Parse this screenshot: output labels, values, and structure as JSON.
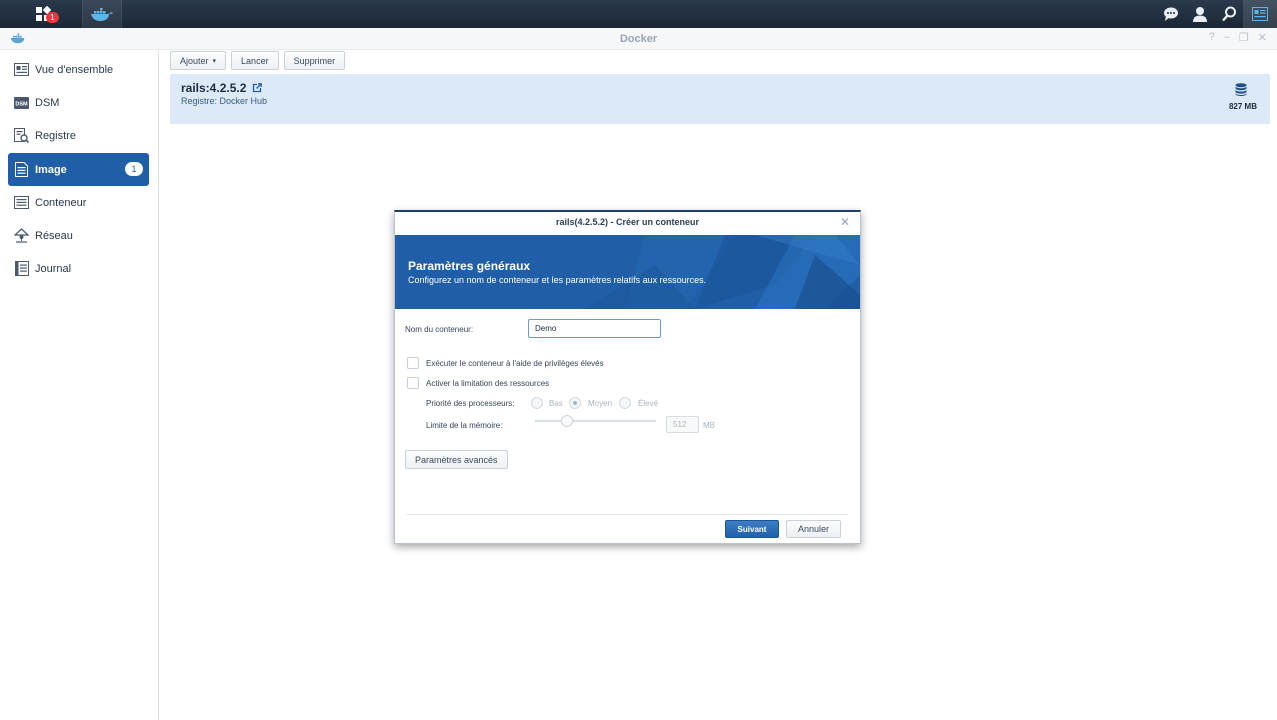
{
  "taskbar": {
    "notification_count": "1"
  },
  "window": {
    "title": "Docker"
  },
  "sidebar": {
    "items": [
      {
        "label": "Vue d'ensemble",
        "icon": "overview-icon"
      },
      {
        "label": "DSM",
        "icon": "dsm-icon"
      },
      {
        "label": "Registre",
        "icon": "registry-icon"
      },
      {
        "label": "Image",
        "icon": "image-icon",
        "badge": "1",
        "active": true
      },
      {
        "label": "Conteneur",
        "icon": "container-icon"
      },
      {
        "label": "Réseau",
        "icon": "network-icon"
      },
      {
        "label": "Journal",
        "icon": "log-icon"
      }
    ]
  },
  "toolbar": {
    "add_label": "Ajouter",
    "launch_label": "Lancer",
    "delete_label": "Supprimer"
  },
  "image": {
    "name": "rails:4.2.5.2",
    "registry": "Registre: Docker Hub",
    "size": "827 MB"
  },
  "dialog": {
    "title": "rails(4.2.5.2) - Créer un conteneur",
    "banner_title": "Paramètres généraux",
    "banner_subtitle": "Configurez un nom de conteneur et les paramètres relatifs aux ressources.",
    "container_name_label": "Nom du conteneur:",
    "container_name_value": "Demo",
    "privileged_label": "Exécuter le conteneur à l'aide de privilèges élevés",
    "resource_limit_label": "Activer la limitation des ressources",
    "cpu_priority_label": "Priorité des processeurs:",
    "cpu_options": [
      "Bas",
      "Moyen",
      "Élevé"
    ],
    "cpu_selected": "Moyen",
    "memory_label": "Limite de la mémoire:",
    "memory_value": "512",
    "memory_unit": "MB",
    "advanced_label": "Paramètres avancés",
    "next_label": "Suivant",
    "cancel_label": "Annuler"
  },
  "colors": {
    "accent": "#205fa8",
    "taskbar": "#1f2d3d",
    "selection": "#dceaf8"
  }
}
